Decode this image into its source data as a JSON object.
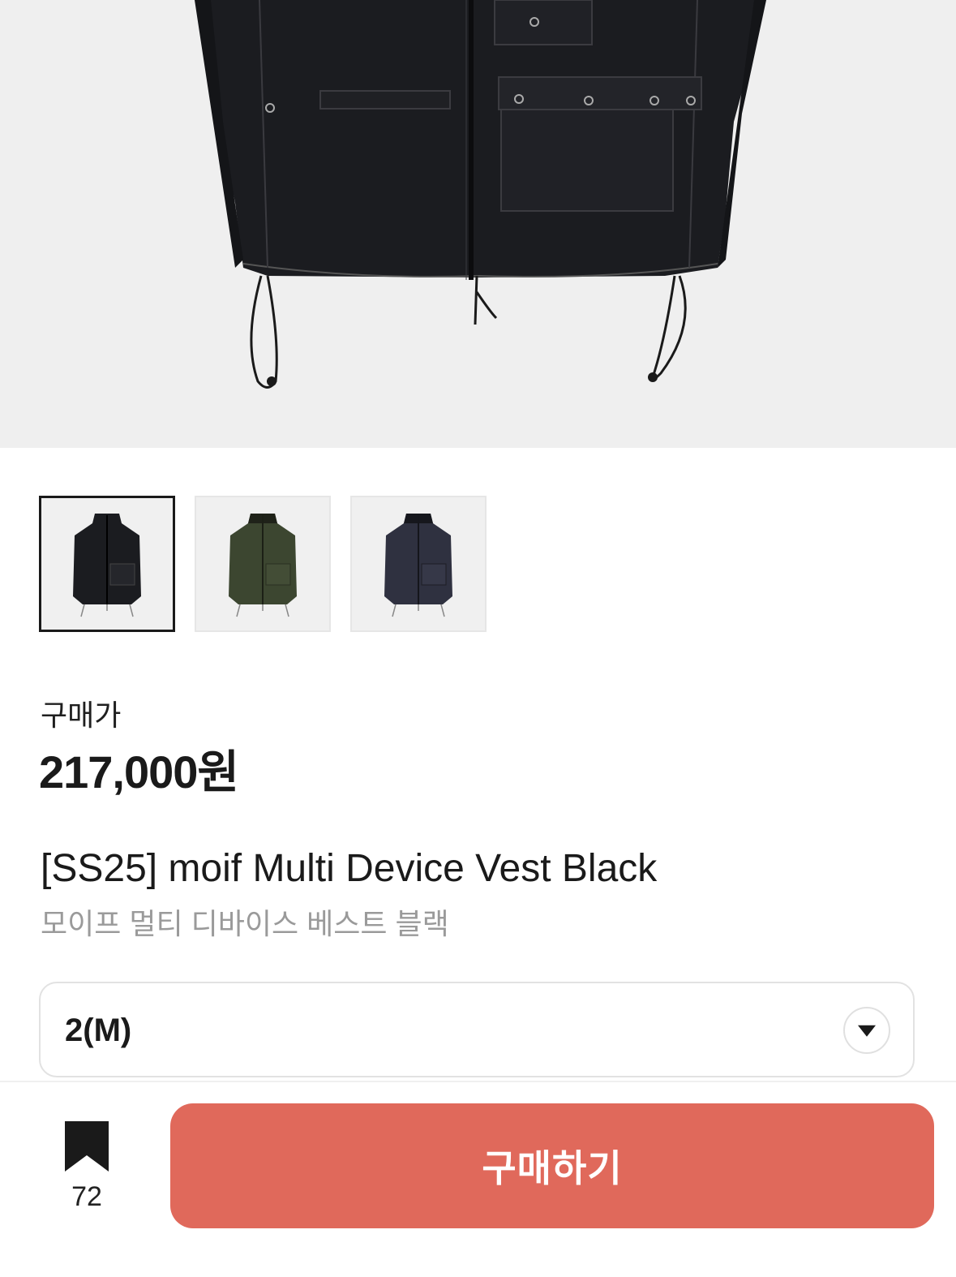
{
  "hero": {
    "image": "product-photo-black-vest-bottom"
  },
  "thumbnails": [
    {
      "color_name": "black",
      "fill": "#1b1c20",
      "selected": true
    },
    {
      "color_name": "olive",
      "fill": "#3c4630",
      "selected": false
    },
    {
      "color_name": "navy",
      "fill": "#2f3140",
      "selected": false
    }
  ],
  "price": {
    "label": "구매가",
    "value": "217,000원"
  },
  "product": {
    "title": "[SS25] moif Multi Device Vest Black",
    "subtitle": "모이프 멀티 디바이스 베스트 블랙"
  },
  "size_select": {
    "selected": "2(M)",
    "icon": "chevron-down-icon"
  },
  "bottom_bar": {
    "bookmark_icon": "bookmark-icon",
    "bookmark_count": "72",
    "buy_label": "구매하기"
  },
  "colors": {
    "accent": "#e0695b",
    "text": "#1a1a1a",
    "muted": "#9a9a9a"
  }
}
